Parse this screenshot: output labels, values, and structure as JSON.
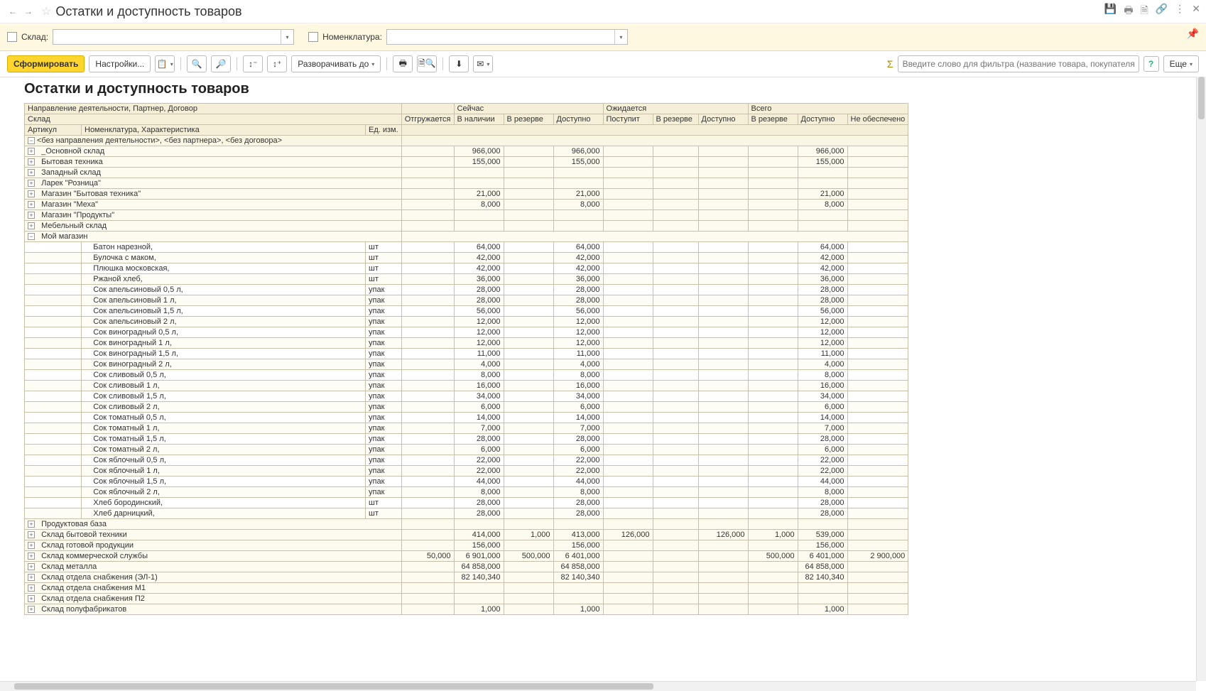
{
  "header": {
    "title": "Остатки и доступность товаров"
  },
  "filters": {
    "warehouse_label": "Склад:",
    "nomenclature_label": "Номенклатура:"
  },
  "toolbar": {
    "generate": "Сформировать",
    "settings": "Настройки...",
    "expand_to": "Разворачивать до",
    "filter_placeholder": "Введите слово для фильтра (название товара, покупателя и пр.)",
    "more": "Еще"
  },
  "report": {
    "title": "Остатки и доступность товаров",
    "hdr": {
      "direction": "Направление деятельности, Партнер, Договор",
      "warehouse": "Склад",
      "article": "Артикул",
      "nomenclature": "Номенклатура, Характеристика",
      "unit": "Ед. изм.",
      "shipping": "Отгружается",
      "now": "Сейчас",
      "in_stock": "В наличии",
      "in_reserve": "В резерве",
      "available": "Доступно",
      "expected": "Ожидается",
      "arrive": "Поступит",
      "total": "Всего",
      "not_provided": "Не обеспечено"
    },
    "group1": "<без направления деятельности>, <без партнера>, <без договора>",
    "warehouses": [
      {
        "name": "_Основной склад",
        "in_stock": "966,000",
        "available": "966,000",
        "t_avail": "966,000",
        "exp": true
      },
      {
        "name": "Бытовая техника",
        "in_stock": "155,000",
        "available": "155,000",
        "t_avail": "155,000",
        "exp": true
      },
      {
        "name": "Западный склад",
        "exp": true
      },
      {
        "name": "Ларек \"Розница\"",
        "exp": true
      },
      {
        "name": "Магазин \"Бытовая техника\"",
        "in_stock": "21,000",
        "available": "21,000",
        "t_avail": "21,000",
        "exp": true
      },
      {
        "name": "Магазин \"Меха\"",
        "in_stock": "8,000",
        "available": "8,000",
        "t_avail": "8,000",
        "exp": true
      },
      {
        "name": "Магазин \"Продукты\"",
        "exp": true
      },
      {
        "name": "Мебельный склад",
        "exp": true
      }
    ],
    "my_shop": {
      "name": "Мой магазин"
    },
    "items": [
      {
        "name": "Батон нарезной,",
        "unit": "шт",
        "v": "64,000"
      },
      {
        "name": "Булочка с маком,",
        "unit": "шт",
        "v": "42,000"
      },
      {
        "name": "Плюшка московская,",
        "unit": "шт",
        "v": "42,000"
      },
      {
        "name": "Ржаной хлеб,",
        "unit": "шт",
        "v": "36,000"
      },
      {
        "name": "Сок апельсиновый 0,5 л,",
        "unit": "упак",
        "v": "28,000"
      },
      {
        "name": "Сок апельсиновый 1 л,",
        "unit": "упак",
        "v": "28,000"
      },
      {
        "name": "Сок апельсиновый 1,5 л,",
        "unit": "упак",
        "v": "56,000"
      },
      {
        "name": "Сок апельсиновый 2 л,",
        "unit": "упак",
        "v": "12,000"
      },
      {
        "name": "Сок виноградный 0,5 л,",
        "unit": "упак",
        "v": "12,000"
      },
      {
        "name": "Сок виноградный 1 л,",
        "unit": "упак",
        "v": "12,000"
      },
      {
        "name": "Сок виноградный 1,5 л,",
        "unit": "упак",
        "v": "11,000"
      },
      {
        "name": "Сок виноградный 2 л,",
        "unit": "упак",
        "v": "4,000"
      },
      {
        "name": "Сок сливовый 0,5 л,",
        "unit": "упак",
        "v": "8,000"
      },
      {
        "name": "Сок сливовый 1 л,",
        "unit": "упак",
        "v": "16,000"
      },
      {
        "name": "Сок сливовый 1,5 л,",
        "unit": "упак",
        "v": "34,000"
      },
      {
        "name": "Сок сливовый 2 л,",
        "unit": "упак",
        "v": "6,000"
      },
      {
        "name": "Сок томатный 0,5 л,",
        "unit": "упак",
        "v": "14,000"
      },
      {
        "name": "Сок томатный 1 л,",
        "unit": "упак",
        "v": "7,000"
      },
      {
        "name": "Сок томатный 1,5 л,",
        "unit": "упак",
        "v": "28,000"
      },
      {
        "name": "Сок томатный 2 л,",
        "unit": "упак",
        "v": "6,000"
      },
      {
        "name": "Сок яблочный 0,5 л,",
        "unit": "упак",
        "v": "22,000"
      },
      {
        "name": "Сок яблочный 1 л,",
        "unit": "упак",
        "v": "22,000"
      },
      {
        "name": "Сок яблочный 1,5 л,",
        "unit": "упак",
        "v": "44,000"
      },
      {
        "name": "Сок яблочный 2 л,",
        "unit": "упак",
        "v": "8,000"
      },
      {
        "name": "Хлеб бородинский,",
        "unit": "шт",
        "v": "28,000"
      },
      {
        "name": "Хлеб дарницкий,",
        "unit": "шт",
        "v": "28,000"
      }
    ],
    "warehouses2": [
      {
        "name": "Продуктовая база",
        "exp": true
      },
      {
        "name": "Склад бытовой техники",
        "in_stock": "414,000",
        "reserve": "1,000",
        "available": "413,000",
        "arrive": "126,000",
        "e_avail": "126,000",
        "t_reserve": "1,000",
        "t_avail": "539,000",
        "exp": true
      },
      {
        "name": "Склад готовой продукции",
        "in_stock": "156,000",
        "available": "156,000",
        "t_avail": "156,000",
        "exp": true
      },
      {
        "name": "Склад коммерческой службы",
        "ship": "50,000",
        "in_stock": "6 901,000",
        "reserve": "500,000",
        "available": "6 401,000",
        "t_reserve": "500,000",
        "t_avail": "6 401,000",
        "not_prov": "2 900,000",
        "exp": true
      },
      {
        "name": "Склад металла",
        "in_stock": "64 858,000",
        "available": "64 858,000",
        "t_avail": "64 858,000",
        "exp": true
      },
      {
        "name": "Склад отдела снабжения (ЭЛ-1)",
        "in_stock": "82 140,340",
        "available": "82 140,340",
        "t_avail": "82 140,340",
        "exp": true
      },
      {
        "name": "Склад отдела снабжения М1",
        "exp": true
      },
      {
        "name": "Склад отдела снабжения П2",
        "exp": true
      },
      {
        "name": "Склад полуфабрикатов",
        "in_stock": "1,000",
        "available": "1,000",
        "t_avail": "1,000",
        "exp": true
      }
    ]
  }
}
